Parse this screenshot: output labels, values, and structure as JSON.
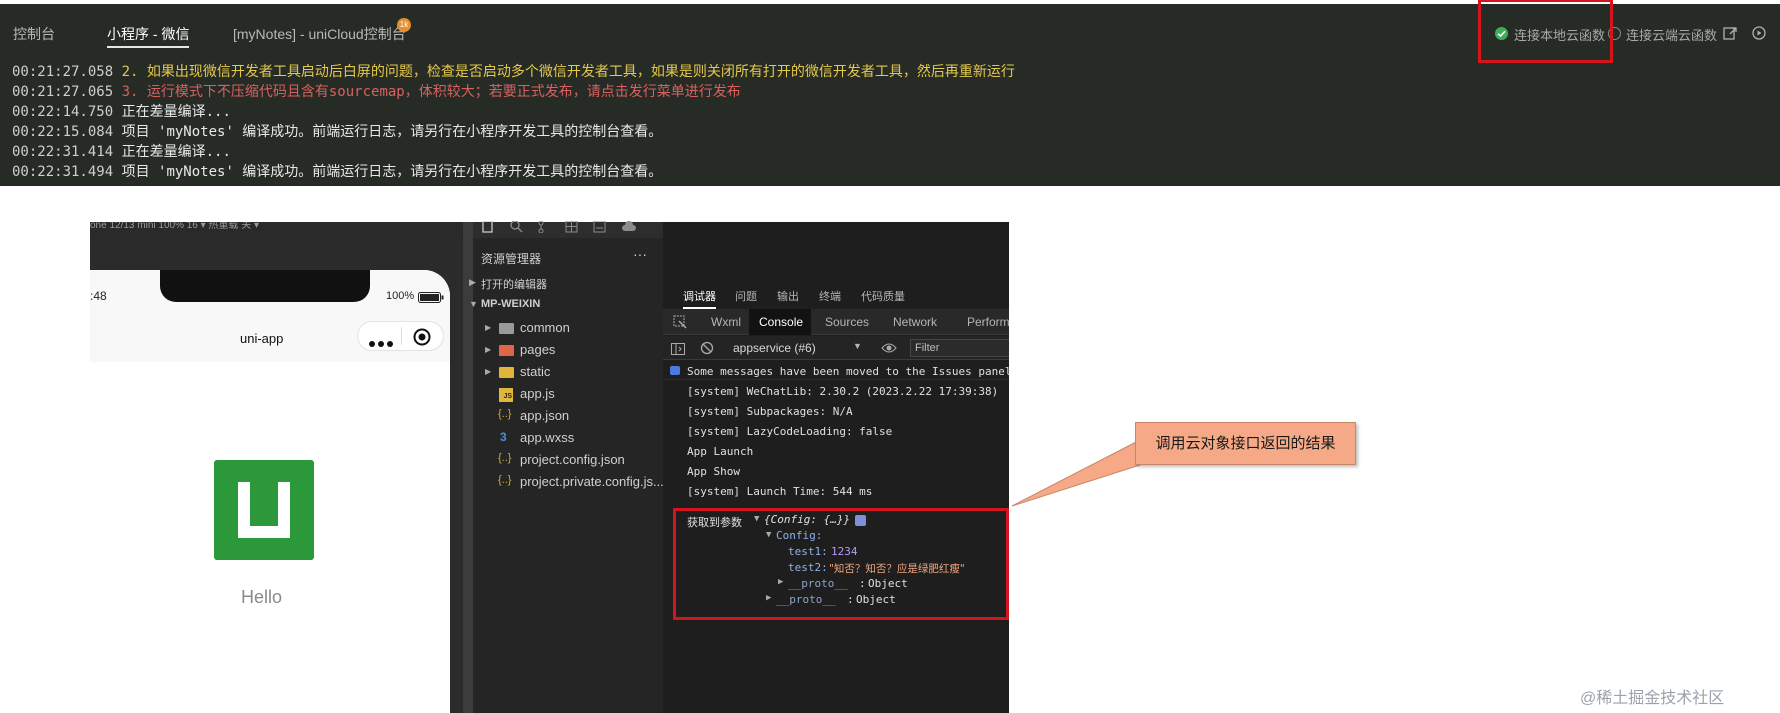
{
  "console": {
    "tabs": [
      {
        "label": "控制台"
      },
      {
        "label": "小程序 - 微信"
      },
      {
        "label": "[myNotes] - uniCloud控制台"
      }
    ],
    "badge": "1k",
    "connect_local": "连接本地云函数",
    "connect_cloud": "连接云端云函数",
    "lines": [
      {
        "time": "00:21:27.058",
        "text": "2. 如果出现微信开发者工具启动后白屏的问题，检查是否启动多个微信开发者工具，如果是则关闭所有打开的微信开发者工具，然后再重新运行",
        "color": "#e5c84a"
      },
      {
        "time": "00:21:27.065",
        "text": "3. 运行模式下不压缩代码且含有sourcemap，体积较大；若要正式发布，请点击发行菜单进行发布",
        "color": "#d7615f"
      },
      {
        "time": "00:22:14.750",
        "text": "正在差量编译...",
        "color": "#e8e8e8"
      },
      {
        "time": "00:22:15.084",
        "text": "项目 'myNotes' 编译成功。前端运行日志，请另行在小程序开发工具的控制台查看。",
        "color": "#e8e8e8"
      },
      {
        "time": "00:22:31.414",
        "text": "正在差量编译...",
        "color": "#e8e8e8"
      },
      {
        "time": "00:22:31.494",
        "text": "项目 'myNotes' 编译成功。前端运行日志，请另行在小程序开发工具的控制台查看。",
        "color": "#e8e8e8"
      }
    ]
  },
  "simulator": {
    "toolbar_text": "one 12/13 mini 100% 16 ▾     热重载 关 ▾",
    "time": ":48",
    "battery": "100%",
    "nav_title": "uni-app",
    "hello": "Hello",
    "logo_color": "#2b9939"
  },
  "explorer": {
    "title": "资源管理器",
    "more": "···",
    "open_editors": "打开的编辑器",
    "project": "MP-WEIXIN",
    "items": [
      {
        "label": "common"
      },
      {
        "label": "pages"
      },
      {
        "label": "static"
      },
      {
        "label": "app.js"
      },
      {
        "label": "app.json"
      },
      {
        "label": "app.wxss"
      },
      {
        "label": "project.config.json"
      },
      {
        "label": "project.private.config.js..."
      }
    ]
  },
  "debugger": {
    "top_tabs": [
      {
        "label": "调试器"
      },
      {
        "label": "问题"
      },
      {
        "label": "输出"
      },
      {
        "label": "终端"
      },
      {
        "label": "代码质量"
      }
    ],
    "panel_tabs": [
      {
        "label": "Wxml"
      },
      {
        "label": "Console"
      },
      {
        "label": "Sources"
      },
      {
        "label": "Network"
      },
      {
        "label": "Perform"
      }
    ],
    "context": "appservice (#6)",
    "filter_placeholder": "Filter",
    "lines": [
      "Some messages have been moved to the Issues panel",
      "[system] WeChatLib: 2.30.2 (2023.2.22 17:39:38)",
      "[system] Subpackages: N/A",
      "[system] LazyCodeLoading: false",
      "App Launch",
      "App Show",
      "[system] Launch Time: 544 ms"
    ],
    "result_label": "获取到参数",
    "result_obj": "{Config: {…}}",
    "config_key": "Config:",
    "test1_key": "test1:",
    "test1_val": "1234",
    "test2_key": "test2:",
    "test2_val": "\"知否？知否？应是绿肥红瘦\"",
    "proto1": "__proto__",
    "proto2": "__proto__",
    "object_word1": "Object",
    "object_word2": "Object"
  },
  "callout": "调用云对象接口返回的结果",
  "watermark": "@稀土掘金技术社区",
  "colors": {
    "accent_red": "#d6141c",
    "callout": "#f6a986",
    "console_bg": "#272b26"
  }
}
